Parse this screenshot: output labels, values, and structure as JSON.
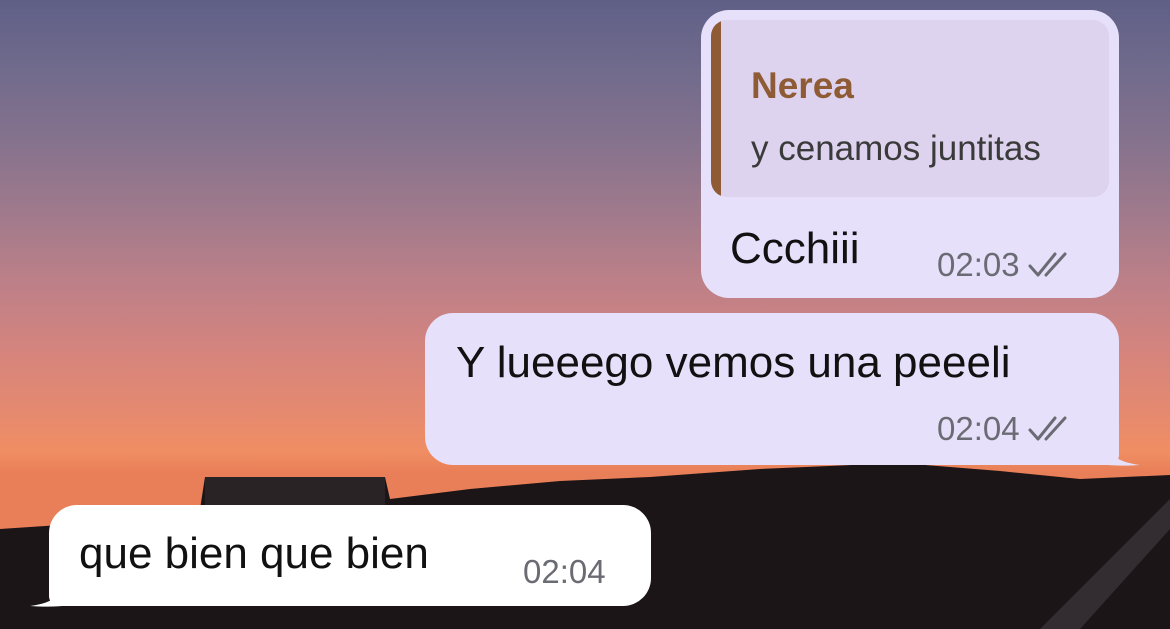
{
  "messages": [
    {
      "direction": "outgoing",
      "reply_to": {
        "author": "Nerea",
        "text": "y cenamos juntitas"
      },
      "text": "Ccchiii",
      "time": "02:03",
      "status_icon": "double-check-icon"
    },
    {
      "direction": "outgoing",
      "text": "Y lueeego vemos una peeeli",
      "time": "02:04",
      "status_icon": "double-check-icon"
    },
    {
      "direction": "incoming",
      "text": "que bien que bien",
      "time": "02:04"
    }
  ],
  "colors": {
    "outgoing_bubble": "#e6e0fb",
    "incoming_bubble": "#ffffff",
    "quote_accent": "#8e5b35"
  }
}
